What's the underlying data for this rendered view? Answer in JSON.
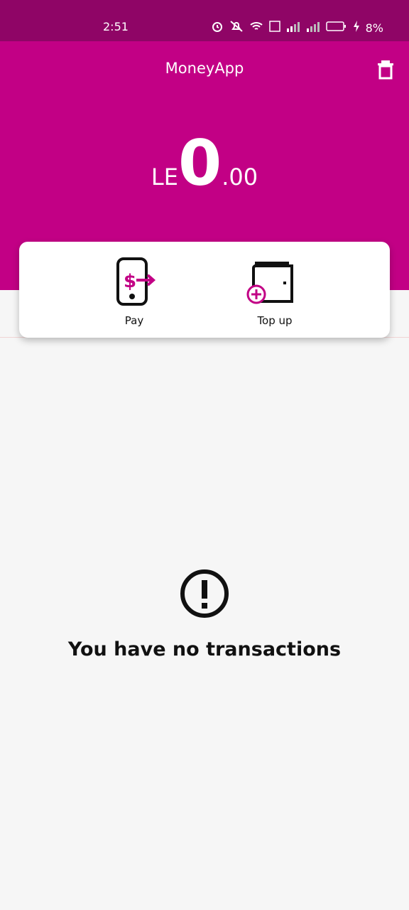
{
  "status_bar": {
    "time": "2:51",
    "battery_percent": "8%"
  },
  "header": {
    "title": "MoneyApp",
    "background_color": "#c20085"
  },
  "balance": {
    "currency": "LE",
    "whole": "0",
    "cents": ".00"
  },
  "actions": [
    {
      "label": "Pay",
      "icon": "phone-pay-icon"
    },
    {
      "label": "Top up",
      "icon": "wallet-plus-icon"
    }
  ],
  "empty_state": {
    "message": "You have no transactions",
    "icon": "alert-icon"
  },
  "colors": {
    "accent": "#c20085",
    "status_bar": "#8f0566"
  }
}
